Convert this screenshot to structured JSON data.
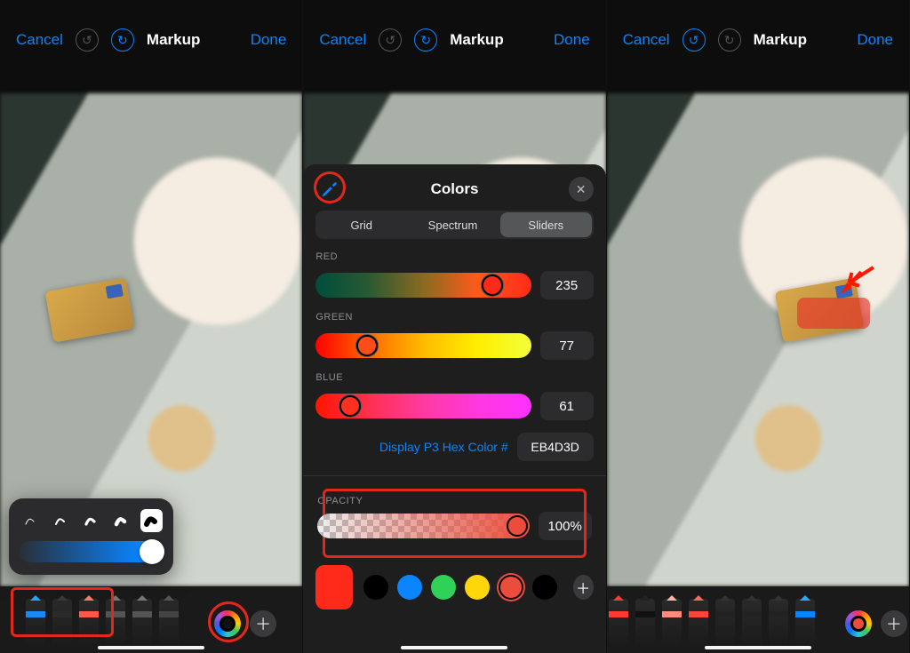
{
  "nav": {
    "cancel": "Cancel",
    "title": "Markup",
    "done": "Done"
  },
  "popover": {
    "brush_sizes": 5
  },
  "color_sheet": {
    "title": "Colors",
    "tabs": {
      "grid": "Grid",
      "spectrum": "Spectrum",
      "sliders": "Sliders",
      "active": "Sliders"
    },
    "channels": {
      "red": {
        "label": "RED",
        "value": "235",
        "pct": 82
      },
      "green": {
        "label": "GREEN",
        "value": "77",
        "pct": 24
      },
      "blue": {
        "label": "BLUE",
        "value": "61",
        "pct": 16
      }
    },
    "hex": {
      "label": "Display P3 Hex Color #",
      "value": "EB4D3D"
    },
    "opacity": {
      "label": "OPACITY",
      "value": "100%",
      "pct": 100
    },
    "swatches": {
      "big": "#ff2a1a",
      "list": [
        "#000000",
        "#0a84ff",
        "#30d158",
        "#ffd60a",
        "#eb4d3d",
        "#000000"
      ],
      "selected_index": 4
    }
  },
  "tools": {
    "p1": [
      {
        "name": "pen",
        "tip": "#22aaff",
        "band": "#1d8af0"
      },
      {
        "name": "marker",
        "tip": "#3a3a3a",
        "band": "#2a2a2a"
      },
      {
        "name": "highlighter",
        "tip": "#ff7a6a",
        "band": "#ff5a48"
      },
      {
        "name": "eraser",
        "tip": "#777",
        "band": "#555"
      },
      {
        "name": "lasso",
        "tip": "#777",
        "band": "#555"
      },
      {
        "name": "ruler",
        "tip": "#555",
        "band": "#444"
      }
    ],
    "p3": [
      {
        "name": "pen",
        "tip": "#ff3b30",
        "band": "#ff3b30"
      },
      {
        "name": "marker",
        "tip": "#222",
        "band": "#111"
      },
      {
        "name": "highlighter",
        "tip": "#ffb0a8",
        "band": "#ff8a80"
      },
      {
        "name": "pencil",
        "tip": "#ff675b",
        "band": "#ff4538"
      },
      {
        "name": "eraser",
        "tip": "#333",
        "band": "#222"
      },
      {
        "name": "lasso",
        "tip": "#333",
        "band": "#222"
      },
      {
        "name": "ruler",
        "tip": "#333",
        "band": "#222"
      },
      {
        "name": "crayon",
        "tip": "#2aa8ff",
        "band": "#0a84ff"
      }
    ]
  }
}
